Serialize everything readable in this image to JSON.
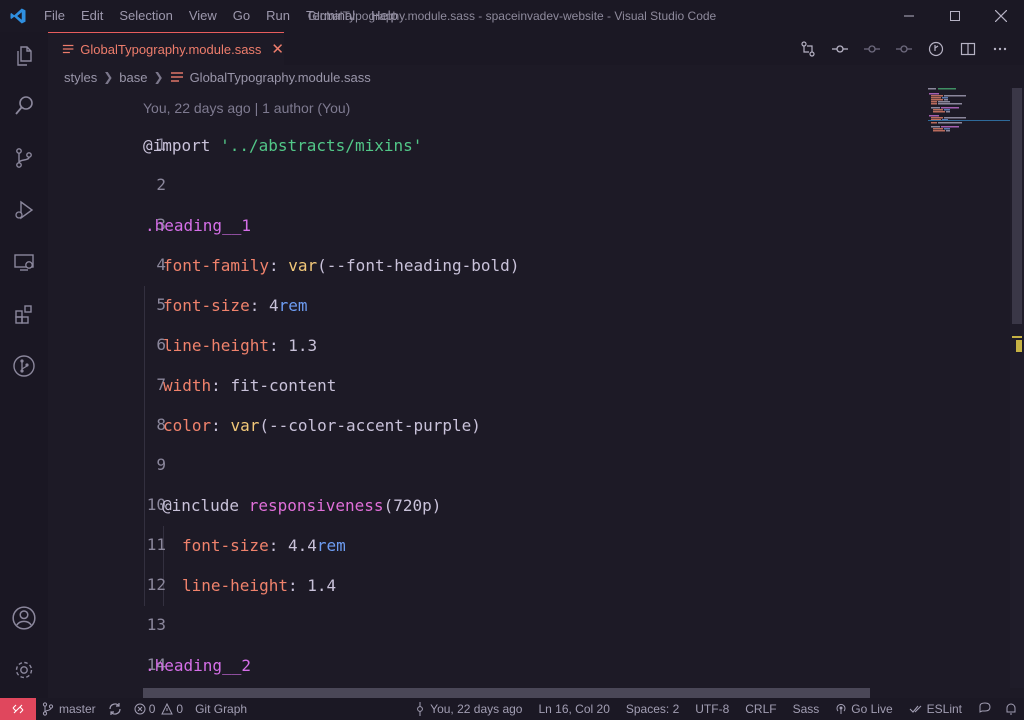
{
  "menu": [
    "File",
    "Edit",
    "Selection",
    "View",
    "Go",
    "Run",
    "Terminal",
    "Help"
  ],
  "window_title": "GlobalTypography.module.sass - spaceinvadev-website - Visual Studio Code",
  "tab": {
    "label": "GlobalTypography.module.sass",
    "close": "✕"
  },
  "breadcrumb": {
    "items": [
      "styles",
      "base",
      "GlobalTypography.module.sass"
    ]
  },
  "blame": "You, 22 days ago | 1 author (You)",
  "line_numbers": [
    "1",
    "2",
    "3",
    "4",
    "5",
    "6",
    "7",
    "8",
    "9",
    "10",
    "11",
    "12",
    "13",
    "14"
  ],
  "code": {
    "l1_kw": "@import",
    "l1_str": "'../abstracts/mixins'",
    "l3_sel": ".heading__1",
    "l4_prop": "font-family",
    "l4_fn": "var",
    "l4_arg": "--font-heading-bold",
    "l5_prop": "font-size",
    "l5_num": "4",
    "l5_unit": "rem",
    "l6_prop": "line-height",
    "l6_val": "1.3",
    "l7_prop": "width",
    "l7_val": "fit-content",
    "l8_prop": "color",
    "l8_fn": "var",
    "l8_arg": "--color-accent-purple",
    "l10_kw": "@include",
    "l10_mix": "responsiveness",
    "l10_arg": "720p",
    "l11_prop": "font-size",
    "l11_num": "4.4",
    "l11_unit": "rem",
    "l12_prop": "line-height",
    "l12_val": "1.4",
    "l14_sel": ".heading__2"
  },
  "status": {
    "branch": "master",
    "errors": "0",
    "warnings": "0",
    "git_graph": "Git Graph",
    "blame": "You, 22 days ago",
    "position": "Ln 16, Col 20",
    "spaces": "Spaces: 2",
    "encoding": "UTF-8",
    "eol": "CRLF",
    "language": "Sass",
    "go_live": "Go Live",
    "eslint": "ESLint"
  },
  "colors": {
    "accent": "#e85d5d",
    "remote": "#e0475d",
    "background": "#1d1a26"
  },
  "icons": [
    "explorer-icon",
    "search-icon",
    "source-control-icon",
    "run-debug-icon",
    "remote-explorer-icon",
    "extensions-icon",
    "git-graph-icon",
    "account-icon",
    "settings-gear-icon"
  ]
}
